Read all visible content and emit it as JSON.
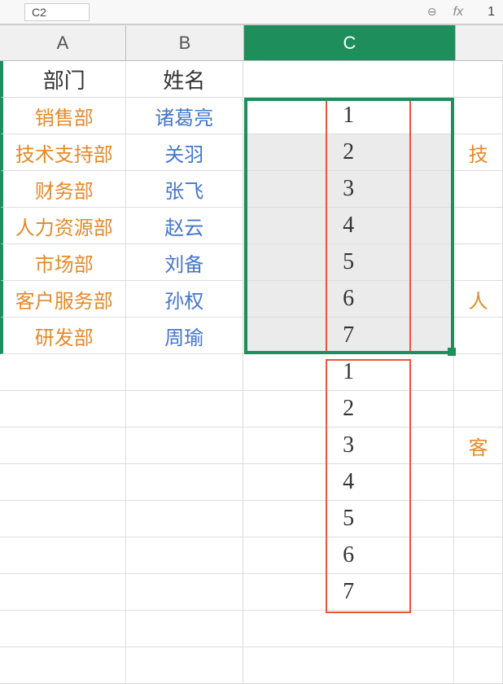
{
  "toolbar": {
    "name_box": "C2",
    "fx_label": "fx",
    "formula_value": "1"
  },
  "columns": {
    "A": "A",
    "B": "B",
    "C": "C"
  },
  "header_row": {
    "dept": "部门",
    "name": "姓名"
  },
  "data_rows": [
    {
      "dept": "销售部",
      "name": "诸葛亮",
      "c": "1"
    },
    {
      "dept": "技术支持部",
      "name": "关羽",
      "c": "2",
      "d": "技"
    },
    {
      "dept": "财务部",
      "name": "张飞",
      "c": "3"
    },
    {
      "dept": "人力资源部",
      "name": "赵云",
      "c": "4"
    },
    {
      "dept": "市场部",
      "name": "刘备",
      "c": "5"
    },
    {
      "dept": "客户服务部",
      "name": "孙权",
      "c": "6",
      "d": "人"
    },
    {
      "dept": "研发部",
      "name": "周瑜",
      "c": "7"
    }
  ],
  "extra_rows": [
    {
      "c": "1"
    },
    {
      "c": "2"
    },
    {
      "c": "3",
      "d": "客"
    },
    {
      "c": "4"
    },
    {
      "c": "5"
    },
    {
      "c": "6"
    },
    {
      "c": "7"
    }
  ],
  "chart_data": {
    "type": "table",
    "title": "",
    "columns": [
      "部门",
      "姓名",
      "C"
    ],
    "rows": [
      [
        "销售部",
        "诸葛亮",
        1
      ],
      [
        "技术支持部",
        "关羽",
        2
      ],
      [
        "财务部",
        "张飞",
        3
      ],
      [
        "人力资源部",
        "赵云",
        4
      ],
      [
        "市场部",
        "刘备",
        5
      ],
      [
        "客户服务部",
        "孙权",
        6
      ],
      [
        "研发部",
        "周瑜",
        7
      ]
    ],
    "extra_c_sequence": [
      1,
      2,
      3,
      4,
      5,
      6,
      7
    ]
  }
}
